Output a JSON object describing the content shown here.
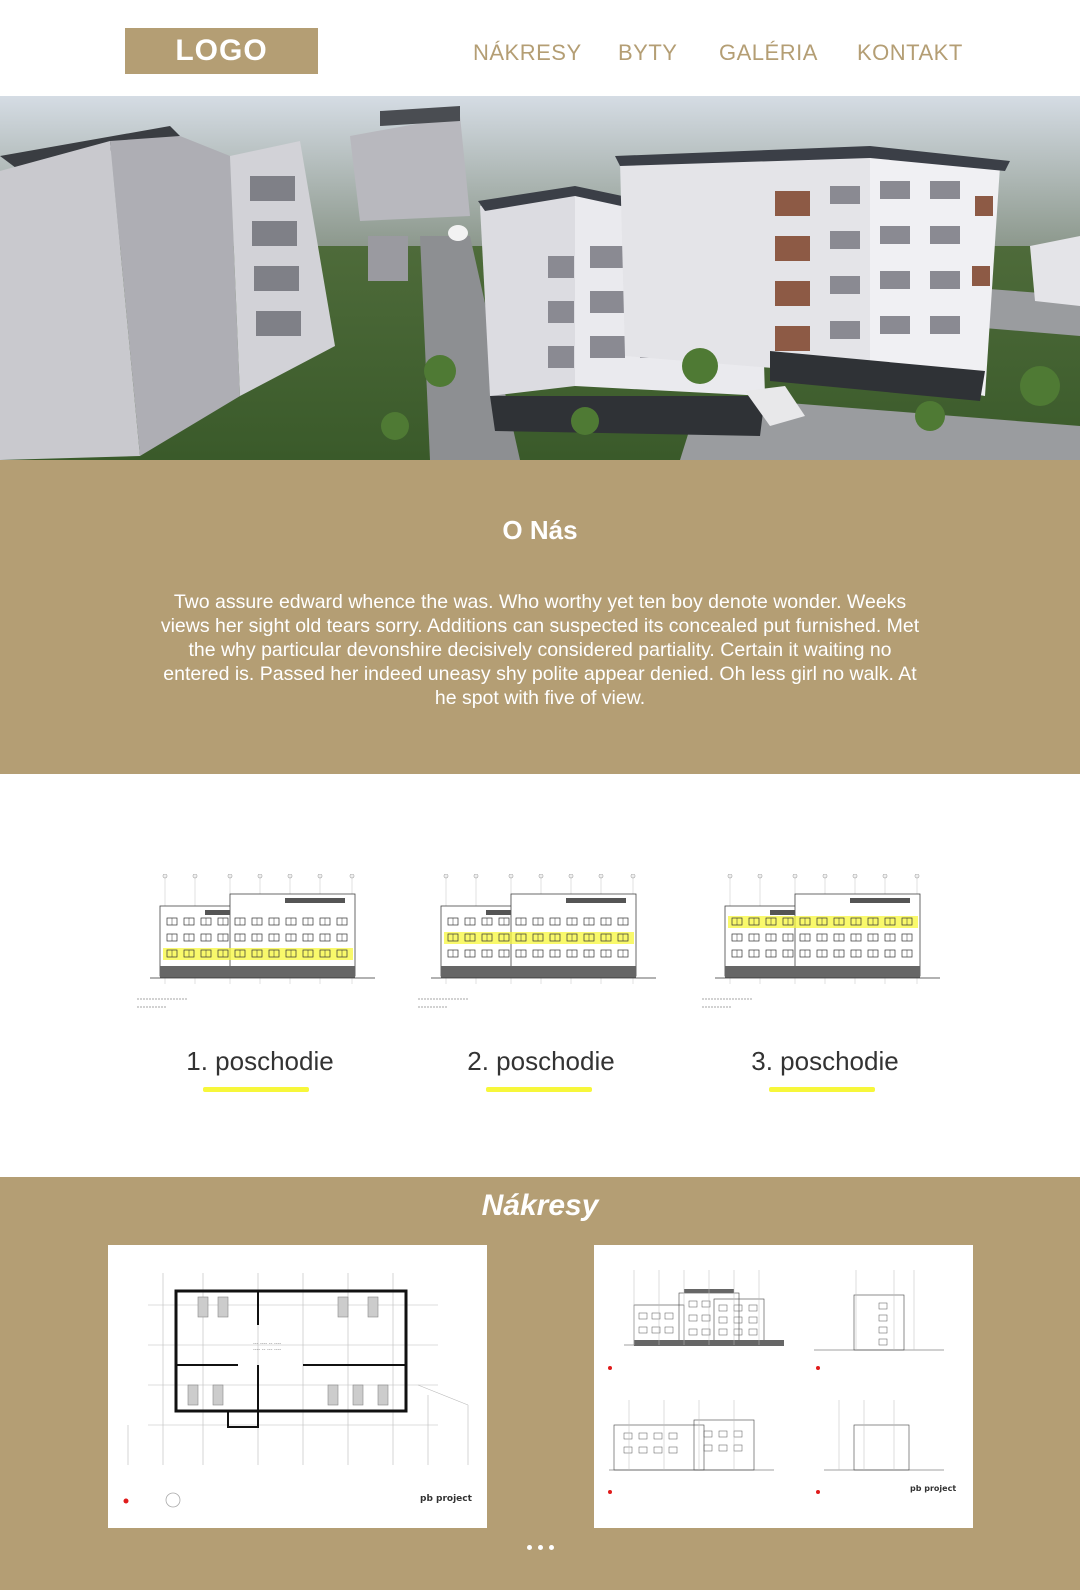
{
  "header": {
    "logo": "LOGO",
    "nav": [
      "NÁKRESY",
      "BYTY",
      "GALÉRIA",
      "KONTAKT"
    ]
  },
  "hero": {
    "image": "building-render"
  },
  "about": {
    "title": "O Nás",
    "text": "Two assure edward whence the was. Who worthy yet ten boy denote wonder. Weeks views her sight old tears sorry. Additions can suspected its concealed put furnished. Met the why particular devonshire decisively considered partiality. Certain it waiting no entered is. Passed her indeed uneasy shy polite appear denied. Oh less girl no walk. At he spot with five of view."
  },
  "floors": [
    {
      "label": "1. poschodie",
      "highlight_floor": 1
    },
    {
      "label": "2. poschodie",
      "highlight_floor": 2
    },
    {
      "label": "3. poschodie",
      "highlight_floor": 3
    }
  ],
  "drawings": {
    "title": "Nákresy",
    "sheets": [
      "floor-plan-sheet",
      "elevations-sheet"
    ],
    "brand": "pb project"
  },
  "colors": {
    "accent": "#b49e74",
    "highlight": "#f7f73a",
    "text_dark": "#333333"
  }
}
